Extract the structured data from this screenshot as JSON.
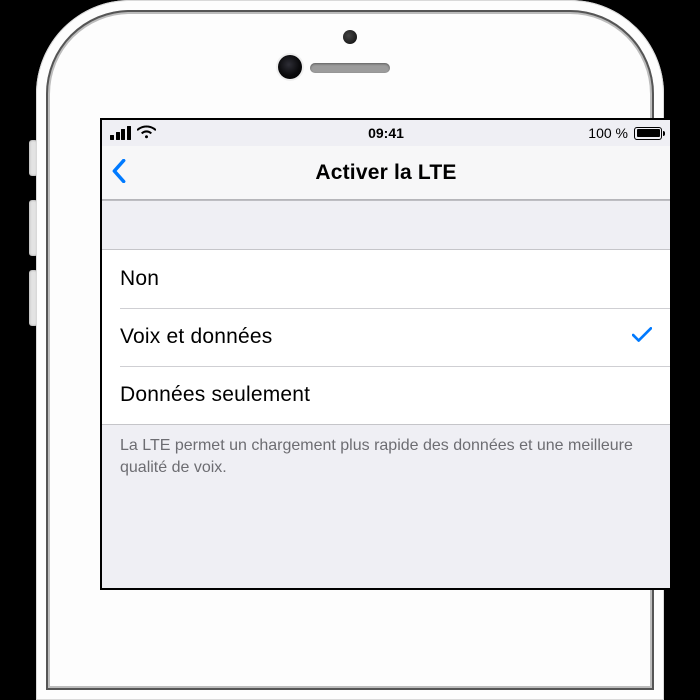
{
  "status": {
    "time": "09:41",
    "battery_text": "100 %"
  },
  "header": {
    "title": "Activer la LTE"
  },
  "options": [
    {
      "label": "Non",
      "selected": false
    },
    {
      "label": "Voix et données",
      "selected": true
    },
    {
      "label": "Données seulement",
      "selected": false
    }
  ],
  "footer": {
    "text": "La LTE permet un chargement plus rapide des données et une meilleure qualité de voix."
  }
}
